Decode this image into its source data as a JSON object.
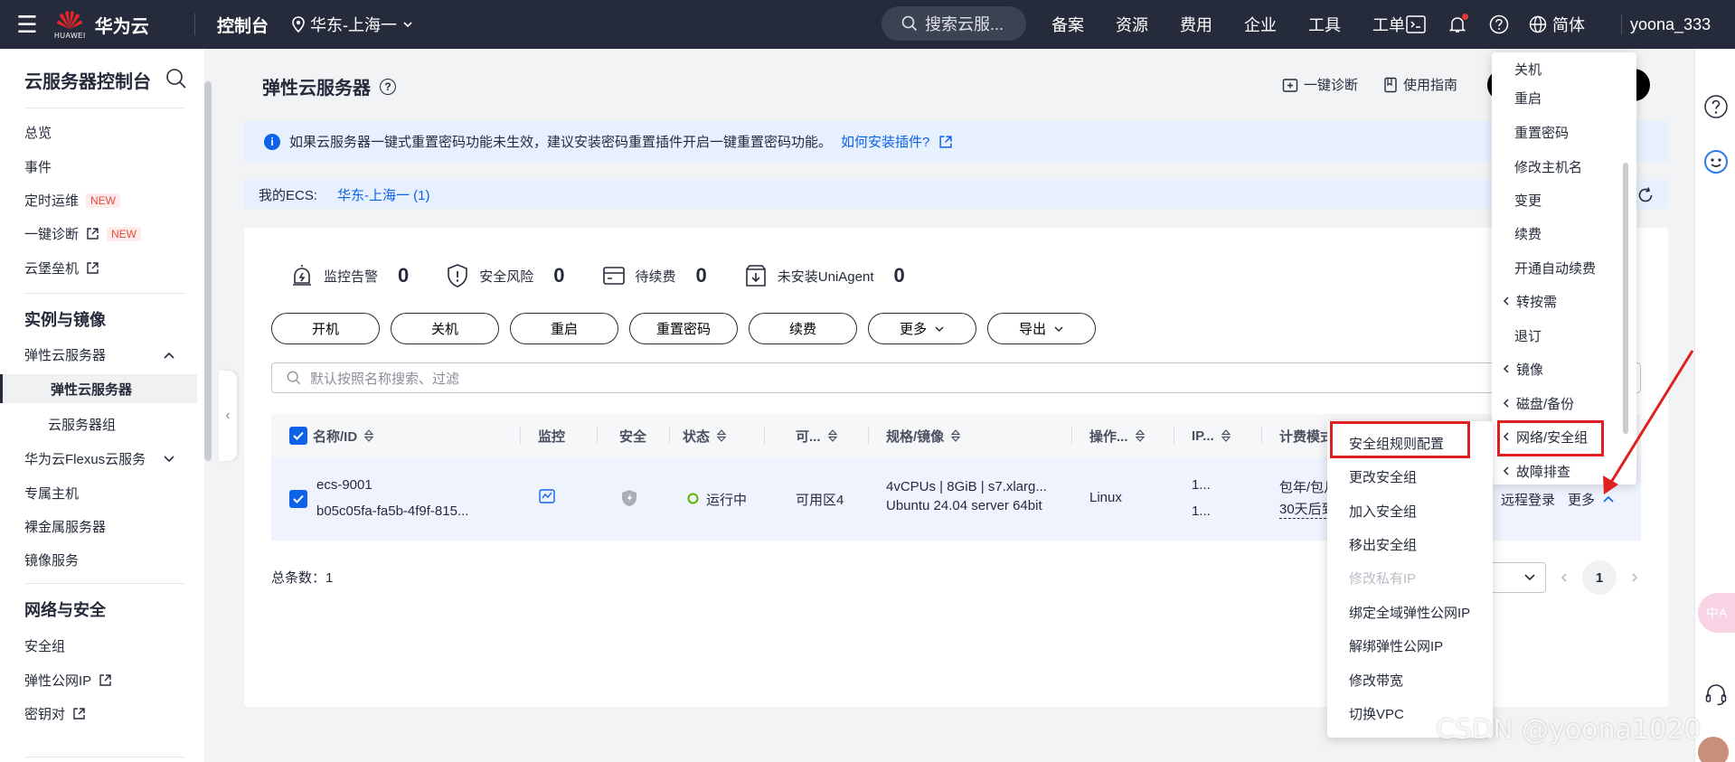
{
  "topbar": {
    "brand_sub": "HUAWEI",
    "brand": "华为云",
    "console": "控制台",
    "region": "华东-上海一",
    "search": "搜索云服...",
    "nav": [
      "备案",
      "资源",
      "费用",
      "企业",
      "工具",
      "工单"
    ],
    "lang": "简体",
    "user": "yoona_333"
  },
  "sidebar": {
    "title": "云服务器控制台",
    "top_items": [
      "总览",
      "事件",
      "定时运维",
      "一键诊断",
      "云堡垒机"
    ],
    "new_tag": "NEW",
    "group1": "实例与镜像",
    "ecs_parent": "弹性云服务器",
    "ecs_active": "弹性云服务器",
    "ecs_group": "云服务器组",
    "flexus": "华为云Flexus云服务",
    "dedicated": "专属主机",
    "bms": "裸金属服务器",
    "ims": "镜像服务",
    "group2": "网络与安全",
    "sg": "安全组",
    "eip": "弹性公网IP",
    "keypair": "密钥对"
  },
  "main": {
    "title": "弹性云服务器",
    "diagnose": "一键诊断",
    "guide": "使用指南",
    "notice": "如果云服务器一键式重置密码功能未生效，建议安装密码重置插件开启一键重置密码功能。",
    "notice_link": "如何安装插件?",
    "myecs_label": "我的ECS:",
    "myecs_region": "华东-上海一 (1)",
    "stats": [
      {
        "label": "监控告警",
        "value": "0"
      },
      {
        "label": "安全风险",
        "value": "0"
      },
      {
        "label": "待续费",
        "value": "0"
      },
      {
        "label": "未安装UniAgent",
        "value": "0"
      }
    ],
    "buttons": [
      "开机",
      "关机",
      "重启",
      "重置密码",
      "续费",
      "更多",
      "导出"
    ],
    "search_placeholder": "默认按照名称搜索、过滤",
    "columns": [
      "名称/ID",
      "监控",
      "安全",
      "状态",
      "可...",
      "规格/镜像",
      "操作...",
      "IP...",
      "计费模式"
    ],
    "row": {
      "name": "ecs-9001",
      "id": "b05c05fa-fa5b-4f9f-815...",
      "status": "运行中",
      "az": "可用区4",
      "spec": "4vCPUs | 8GiB | s7.xlarg...",
      "image": "Ubuntu 24.04 server 64bit",
      "os": "Linux",
      "ip1": "1...",
      "ip2": "1...",
      "billing1": "包年/包月",
      "billing2": "30天后到",
      "remote": "远程登录",
      "more": "更多"
    },
    "total": "总条数：1",
    "page": "1"
  },
  "more_menu": [
    "关机",
    "重启",
    "重置密码",
    "修改主机名",
    "变更",
    "续费",
    "开通自动续费",
    "转按需",
    "退订",
    "镜像",
    "磁盘/备份",
    "网络/安全组",
    "故障排查"
  ],
  "sub_menu": [
    {
      "label": "安全组规则配置",
      "disabled": false
    },
    {
      "label": "更改安全组",
      "disabled": false
    },
    {
      "label": "加入安全组",
      "disabled": false
    },
    {
      "label": "移出安全组",
      "disabled": false
    },
    {
      "label": "修改私有IP",
      "disabled": true
    },
    {
      "label": "绑定全域弹性公网IP",
      "disabled": false
    },
    {
      "label": "解绑弹性公网IP",
      "disabled": false
    },
    {
      "label": "修改带宽",
      "disabled": false
    },
    {
      "label": "切换VPC",
      "disabled": false
    }
  ],
  "watermark": "CSDN @yoona1020",
  "colors": {
    "topbar": "#252b3a",
    "accent": "#0d62e7",
    "highlight": "#e02020",
    "running": "#5cb300"
  }
}
